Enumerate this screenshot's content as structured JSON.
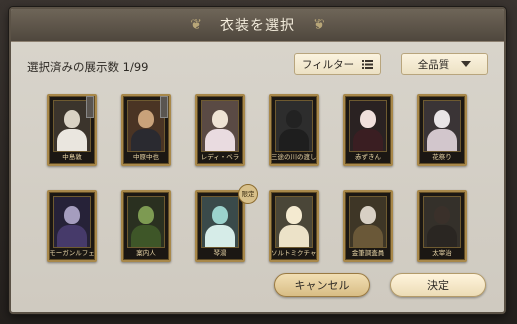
{
  "dialog": {
    "title": "衣装を選択",
    "count_label": "選択済みの展示数 1/99",
    "filter_label": "フィルター",
    "quality_label": "全品質",
    "cancel_label": "キャンセル",
    "confirm_label": "決定"
  },
  "cards": [
    {
      "name": "中島敦",
      "head": "#d9d2c4",
      "body": "#eae6df",
      "bg": "#3b342c",
      "tag": true,
      "badge": ""
    },
    {
      "name": "中原中也",
      "head": "#c9a27a",
      "body": "#2a2a30",
      "bg": "#4a3424",
      "tag": true,
      "badge": ""
    },
    {
      "name": "レディ・ベラ",
      "head": "#efe3d4",
      "body": "#e9dbe0",
      "bg": "#5a4a44",
      "tag": false,
      "badge": ""
    },
    {
      "name": "三途の川の渡し守",
      "head": "#222222",
      "body": "#1e1e1e",
      "bg": "#2d2d2d",
      "tag": false,
      "badge": ""
    },
    {
      "name": "赤ずきん",
      "head": "#f0e0dc",
      "body": "#3a1e22",
      "bg": "#2a2222",
      "tag": false,
      "badge": ""
    },
    {
      "name": "花祭り",
      "head": "#e8e4e6",
      "body": "#d2c6cc",
      "bg": "#3a3436",
      "tag": false,
      "badge": ""
    },
    {
      "name": "モーガンルフェ",
      "head": "#a59dbe",
      "body": "#463a6a",
      "bg": "#262238",
      "tag": false,
      "badge": ""
    },
    {
      "name": "案内人",
      "head": "#7d9a52",
      "body": "#3e5628",
      "bg": "#2a3020",
      "tag": false,
      "badge": ""
    },
    {
      "name": "琴湯",
      "head": "#9bd2cc",
      "body": "#d6ece8",
      "bg": "#3a4a4a",
      "tag": false,
      "badge": "限定"
    },
    {
      "name": "ソルトミクチャル",
      "head": "#f4ead0",
      "body": "#ece2c8",
      "bg": "#4a4638",
      "tag": false,
      "badge": ""
    },
    {
      "name": "金筆調査員",
      "head": "#d8d0c4",
      "body": "#6a5838",
      "bg": "#3e3626",
      "tag": false,
      "badge": ""
    },
    {
      "name": "太宰治",
      "head": "#3a302a",
      "body": "#2a2622",
      "bg": "#34302a",
      "tag": false,
      "badge": ""
    }
  ],
  "icons": {
    "filter": "list-icon",
    "quality": "chevron-down-icon",
    "title_deco": "laurel-icon"
  }
}
